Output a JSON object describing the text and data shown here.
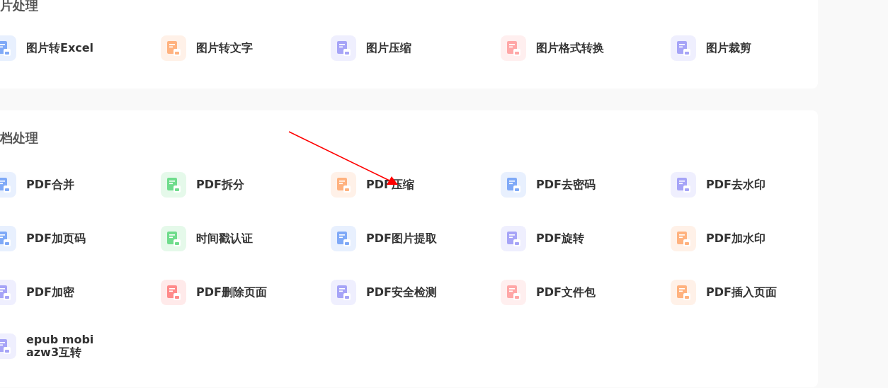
{
  "sections": [
    {
      "title": "片处理",
      "items": [
        {
          "label": "图片转Excel",
          "color": "#7fa9f7"
        },
        {
          "label": "图片转文字",
          "color": "#ffb27f"
        },
        {
          "label": "图片压缩",
          "color": "#a6a4f7"
        },
        {
          "label": "图片格式转换",
          "color": "#ffa7a7"
        },
        {
          "label": "图片裁剪",
          "color": "#a6a4f7"
        }
      ]
    },
    {
      "title": "档处理",
      "items": [
        {
          "label": "PDF合并",
          "color": "#7fa9f7"
        },
        {
          "label": "PDF拆分",
          "color": "#6fdc8c"
        },
        {
          "label": "PDF压缩",
          "color": "#ffb27f"
        },
        {
          "label": "PDF去密码",
          "color": "#7fa9f7"
        },
        {
          "label": "PDF去水印",
          "color": "#a6a4f7"
        },
        {
          "label": "PDF加页码",
          "color": "#7fa9f7"
        },
        {
          "label": "时间戳认证",
          "color": "#6fdc8c"
        },
        {
          "label": "PDF图片提取",
          "color": "#7fa9f7"
        },
        {
          "label": "PDF旋转",
          "color": "#a6a4f7"
        },
        {
          "label": "PDF加水印",
          "color": "#ffb27f"
        },
        {
          "label": "PDF加密",
          "color": "#a6a4f7"
        },
        {
          "label": "PDF删除页面",
          "color": "#ff8a8a"
        },
        {
          "label": "PDF安全检测",
          "color": "#a6a4f7"
        },
        {
          "label": "PDF文件包",
          "color": "#ffa7a7"
        },
        {
          "label": "PDF插入页面",
          "color": "#ffb27f"
        },
        {
          "label": "epub mobi azw3互转",
          "color": "#a6a4f7"
        }
      ]
    }
  ]
}
